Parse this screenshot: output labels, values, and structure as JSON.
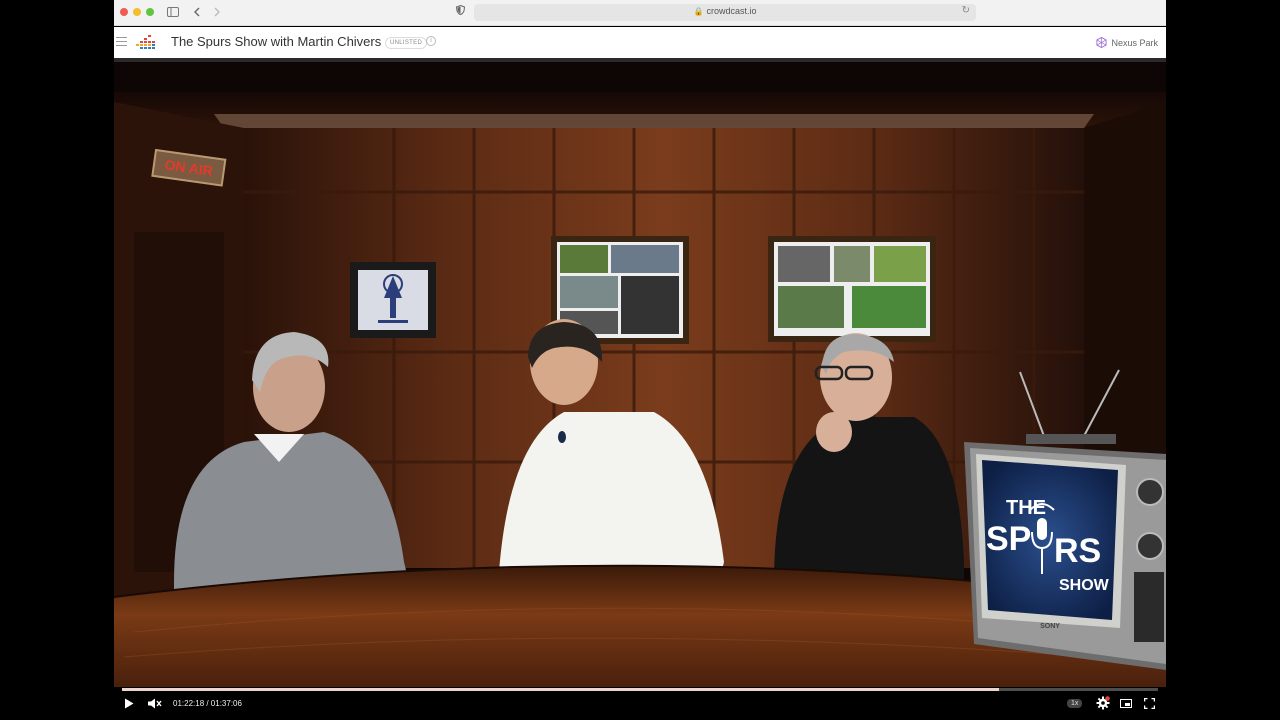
{
  "browser": {
    "url": "crowdcast.io",
    "icons": [
      "sidebar-toggle-icon",
      "back-icon",
      "forward-icon",
      "shield-icon",
      "lock-icon",
      "reload-icon"
    ]
  },
  "header": {
    "title": "The Spurs Show with Martin Chivers",
    "badge": "UNLISTED",
    "org_name": "Nexus Park"
  },
  "scene": {
    "on_air_sign": "ON AIR",
    "tv_logo_line1": "THE",
    "tv_logo_line2": "SP",
    "tv_logo_line3": "RS",
    "tv_logo_line4": "SHOW",
    "tv_brand": "SONY"
  },
  "player": {
    "current_time": "01:22:18",
    "duration": "01:37:06",
    "time_display": "01:22:18 / 01:37:06",
    "progress_fraction": 0.847,
    "speed": "1x",
    "muted": true
  },
  "colors": {
    "accent_red": "#e2463a",
    "player_progress": "#e8d8d0",
    "wood_dark": "#3a1a0c",
    "wood_mid": "#6b3418"
  }
}
